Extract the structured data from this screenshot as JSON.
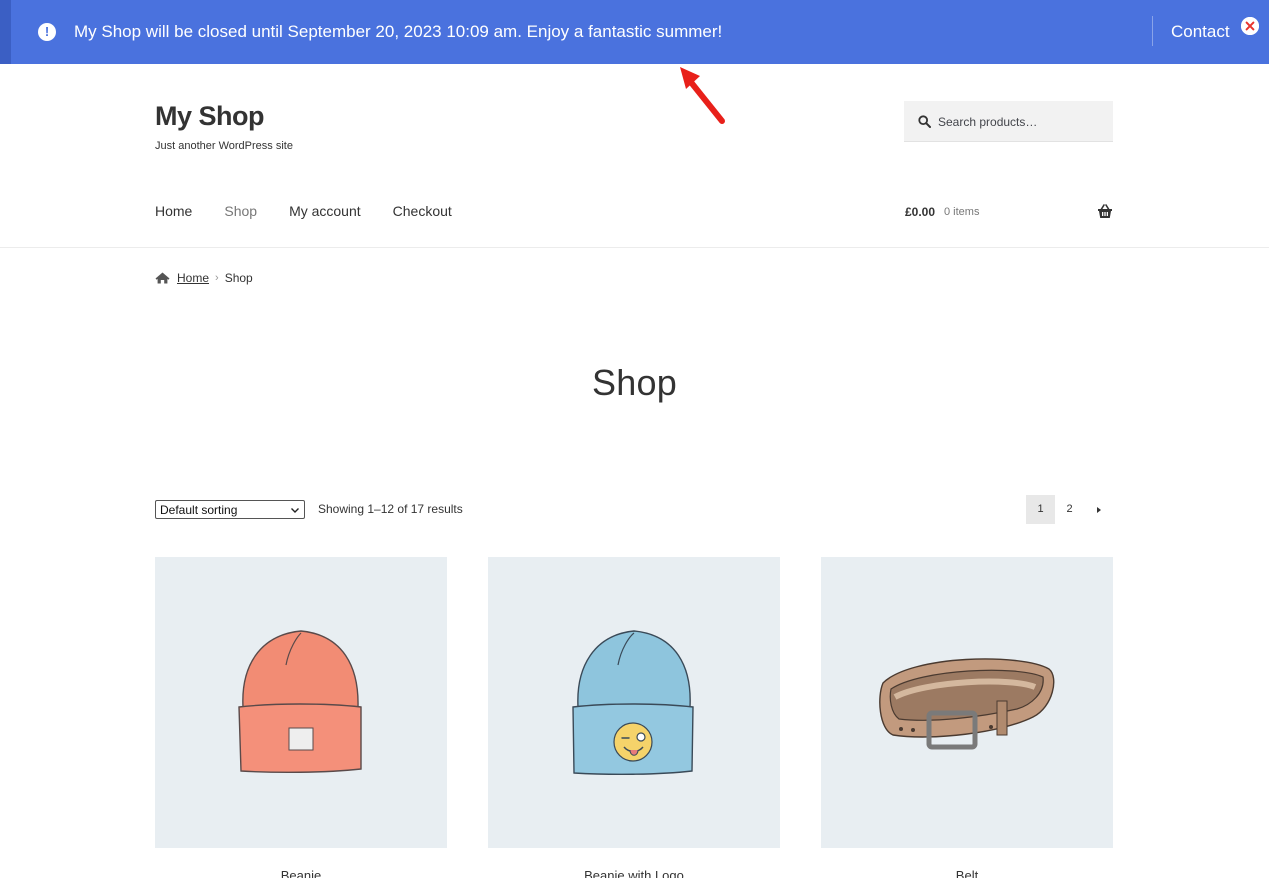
{
  "notice": {
    "message": "My Shop will be closed until September 20, 2023 10:09 am. Enjoy a fantastic summer!",
    "contact_label": "Contact",
    "icon": "alert-circle-icon",
    "close_icon": "close-icon",
    "background": "#4a72de"
  },
  "header": {
    "site_title": "My Shop",
    "tagline": "Just another WordPress site",
    "search": {
      "placeholder": "Search products…",
      "icon": "search-icon"
    }
  },
  "nav": {
    "items": [
      {
        "label": "Home"
      },
      {
        "label": "Shop",
        "active": true
      },
      {
        "label": "My account"
      },
      {
        "label": "Checkout"
      }
    ]
  },
  "cart": {
    "amount": "£0.00",
    "count": "0 items",
    "icon": "basket-icon"
  },
  "breadcrumb": {
    "home": "Home",
    "separator": "›",
    "current": "Shop"
  },
  "page": {
    "title": "Shop"
  },
  "toolbar": {
    "sort_selected": "Default sorting",
    "result_count": "Showing 1–12 of 17 results",
    "pages": [
      "1",
      "2"
    ],
    "current_page": "1"
  },
  "products": [
    {
      "name": "Beanie",
      "image": "orange-beanie"
    },
    {
      "name": "Beanie with Logo",
      "image": "blue-beanie-with-emoji-logo"
    },
    {
      "name": "Belt",
      "image": "brown-leather-belt"
    }
  ],
  "colors": {
    "accent": "#4a72de",
    "annotation_arrow": "#e8201a",
    "product_bg": "#e8eef2"
  }
}
